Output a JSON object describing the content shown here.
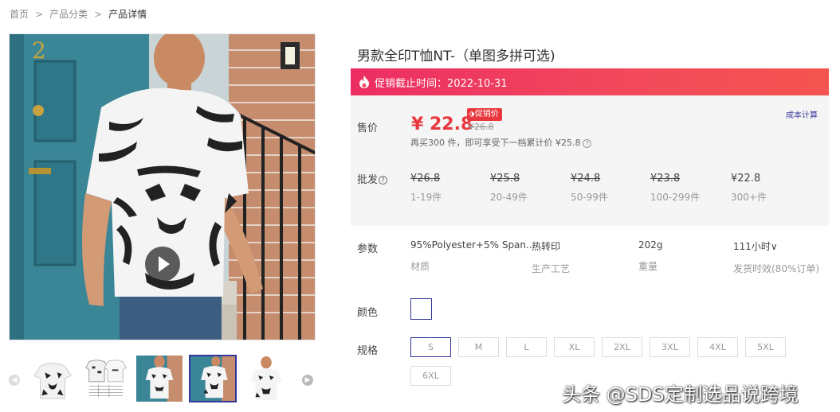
{
  "breadcrumb": {
    "items": [
      "首页",
      "产品分类",
      "产品详情"
    ],
    "separator": ">"
  },
  "product": {
    "title": "男款全印T恤NT-（单图多拼可选)"
  },
  "promo": {
    "text": "促销截止时间：2022-10-31",
    "gradient": [
      "#ec2d63",
      "#f4544f"
    ]
  },
  "price": {
    "label": "售价",
    "current": "¥ 22.8",
    "tag": "促销价",
    "original": "¥26.8",
    "hint": "再买300 件，即可享受下一档累计价 ¥25.8",
    "cost_calc": "成本计算",
    "color": "#e8383d"
  },
  "wholesale": {
    "label": "批发",
    "tiers": [
      {
        "price": "¥26.8",
        "qty": "1-19件",
        "struck": true
      },
      {
        "price": "¥25.8",
        "qty": "20-49件",
        "struck": true
      },
      {
        "price": "¥24.8",
        "qty": "50-99件",
        "struck": true
      },
      {
        "price": "¥23.8",
        "qty": "100-299件",
        "struck": true
      },
      {
        "price": "¥22.8",
        "qty": "300+件",
        "struck": false
      }
    ]
  },
  "params": {
    "label": "参数",
    "items": [
      {
        "value": "95%Polyester+5% Span...",
        "key": "材质"
      },
      {
        "value": "热转印",
        "key": "生产工艺"
      },
      {
        "value": "202g",
        "key": "重量"
      },
      {
        "value": "111小时∨",
        "key": "发货时效(80%订单)"
      }
    ]
  },
  "color_option": {
    "label": "颜色"
  },
  "sizes": {
    "label": "规格",
    "options": [
      "S",
      "M",
      "L",
      "XL",
      "2XL",
      "3XL",
      "4XL",
      "5XL",
      "6XL"
    ],
    "selected": "S"
  },
  "gallery": {
    "thumb_count": 5,
    "active_index": 3
  },
  "watermark": "头条 @SDS定制选品说跨境",
  "colors": {
    "accent": "#33369a",
    "promo_red": "#e8383d"
  }
}
